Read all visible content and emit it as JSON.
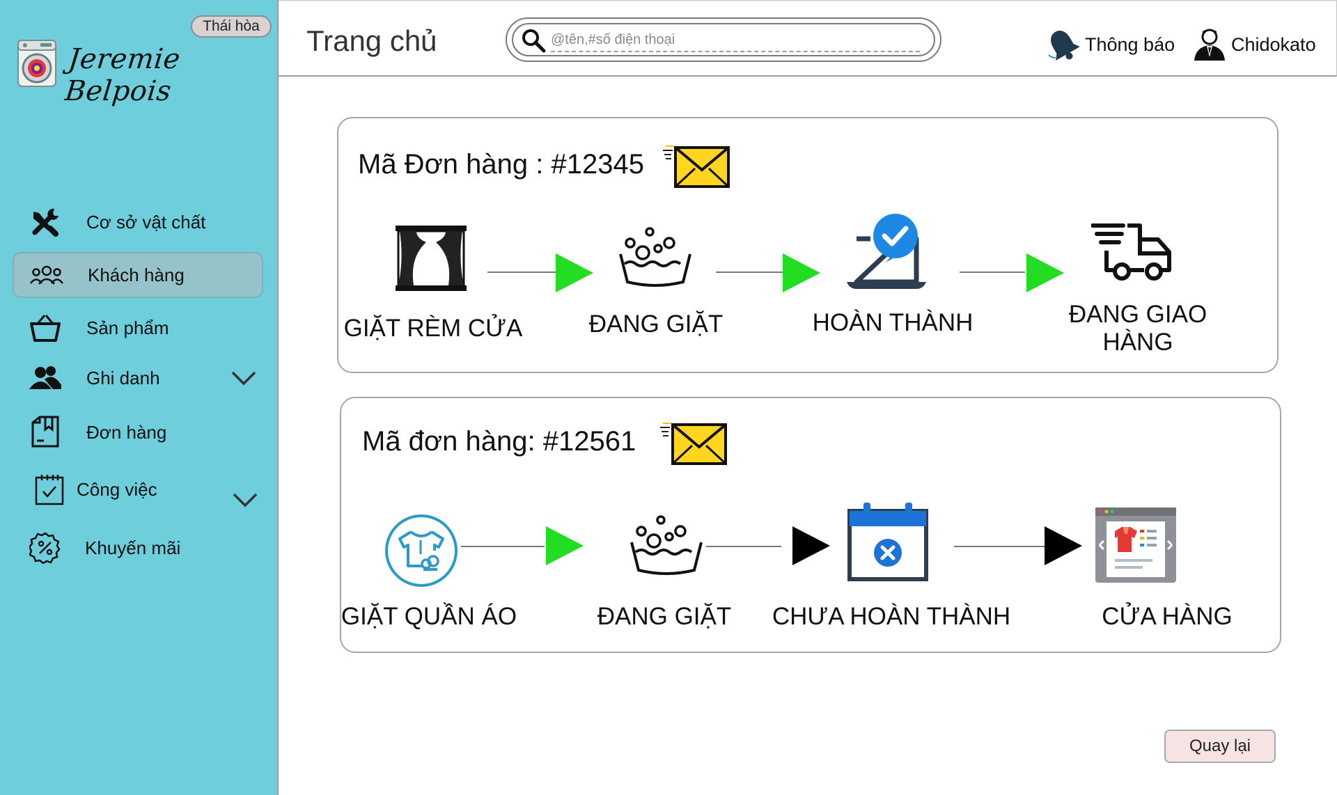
{
  "branch": "Thái hòa",
  "brand": {
    "name": "Jeremie Belpois"
  },
  "header": {
    "title": "Trang chủ",
    "search_placeholder": "@tên,#số điện thoại",
    "notifications_label": "Thông báo",
    "user_name": "Chidokato"
  },
  "sidebar": {
    "items": [
      {
        "label": "Cơ sở vật chất",
        "icon": "tools-icon"
      },
      {
        "label": "Khách hàng",
        "icon": "customers-icon",
        "active": true
      },
      {
        "label": "Sản phẩm",
        "icon": "basket-icon"
      },
      {
        "label": "Ghi danh",
        "icon": "users-icon",
        "expandable": true
      },
      {
        "label": "Đơn hàng",
        "icon": "order-box-icon"
      },
      {
        "label": "Công việc",
        "icon": "calendar-check-icon",
        "expandable": true
      },
      {
        "label": "Khuyến mãi",
        "icon": "discount-badge-icon"
      }
    ]
  },
  "orders": [
    {
      "title": "Mã Đơn hàng : #12345",
      "steps": [
        {
          "label": "GIẶT RÈM CỬA",
          "icon": "curtain-icon"
        },
        {
          "label": "ĐANG GIẶT",
          "icon": "washing-basin-icon"
        },
        {
          "label": "HOÀN THÀNH",
          "icon": "laptop-check-icon"
        },
        {
          "label": "ĐANG GIAO HÀNG",
          "icon": "delivery-truck-icon"
        }
      ],
      "arrow_colors": [
        "#22dd22",
        "#22dd22",
        "#22dd22"
      ]
    },
    {
      "title": "Mã đơn hàng: #12561",
      "steps": [
        {
          "label": "GIẶT QUẦN ÁO",
          "icon": "shirt-wash-icon"
        },
        {
          "label": "ĐANG GIẶT",
          "icon": "washing-basin-icon"
        },
        {
          "label": "CHƯA HOÀN THÀNH",
          "icon": "calendar-cancel-icon"
        },
        {
          "label": "CỬA HÀNG",
          "icon": "store-window-icon"
        }
      ],
      "arrow_colors": [
        "#22dd22",
        "#000000",
        "#000000"
      ]
    }
  ],
  "actions": {
    "back_label": "Quay lại"
  },
  "colors": {
    "sidebar": "#6fcedb",
    "active_item": "#95c3c9",
    "arrow_done": "#22dd22",
    "arrow_pending": "#000000",
    "back_button": "#f6e3e4"
  }
}
